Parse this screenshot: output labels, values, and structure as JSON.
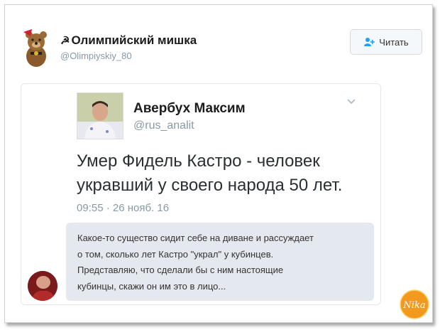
{
  "account": {
    "name": "Олимпийский мишка",
    "handle": "@Olimpiyskiy_80"
  },
  "follow_button": {
    "label": "Читать"
  },
  "quoted_tweet": {
    "author_name": "Авербух Максим",
    "author_handle": "@rus_analit",
    "text": "Умер Фидель Кастро - человек укравший у своего народа 50 лет.",
    "time": "09:55 · 26 нояб. 16"
  },
  "comment": {
    "lines": [
      "Какое-то существо сидит себе на диване и рассуждает",
      "о том, сколько лет Кастро \"украл\" у кубинцев.",
      "Представляю, что сделали бы с ним настоящие",
      "кубинцы, скажи он им это в лицо..."
    ]
  },
  "watermark": {
    "text": "Nika"
  },
  "colors": {
    "muted": "#8899a6",
    "bubble": "#e3e9ee",
    "watermark": "#f29a1f"
  }
}
